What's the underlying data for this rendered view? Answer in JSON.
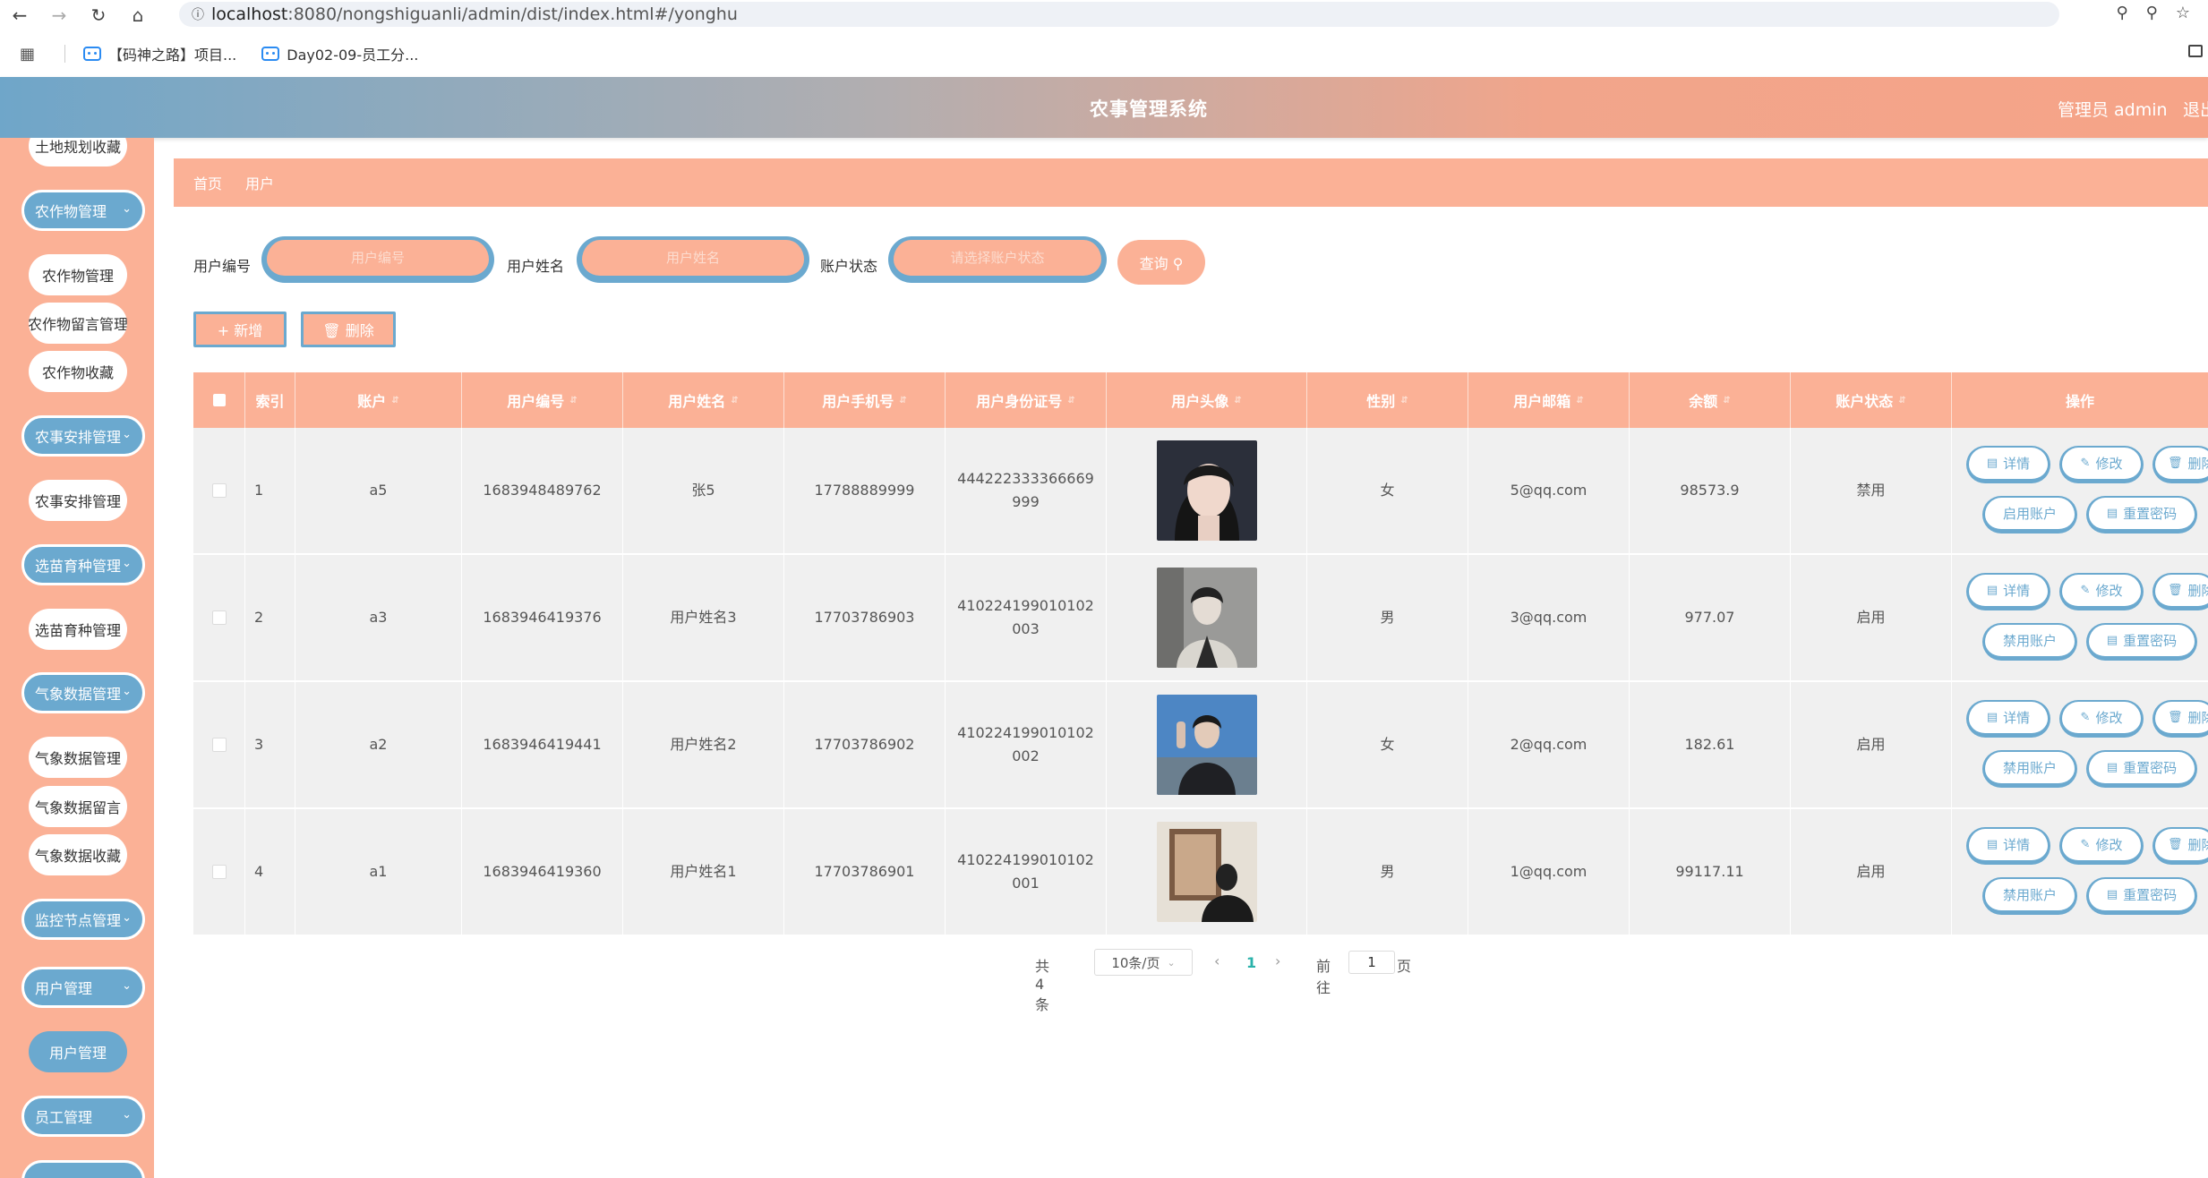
{
  "browser": {
    "url_host": "localhost",
    "url_rest": ":8080/nongshiguanli/admin/dist/index.html#/yonghu",
    "bookmarks": [
      "【码神之路】项目...",
      "Day02-09-员工分..."
    ]
  },
  "header": {
    "title": "农事管理系统",
    "user": "管理员 admin",
    "logout": "退出"
  },
  "sidebar": {
    "items": [
      {
        "label": "土地规划收藏",
        "kind": "sub"
      },
      {
        "label": "农作物管理",
        "kind": "group"
      },
      {
        "label": "农作物管理",
        "kind": "sub"
      },
      {
        "label": "农作物留言管理",
        "kind": "sub"
      },
      {
        "label": "农作物收藏",
        "kind": "sub"
      },
      {
        "label": "农事安排管理",
        "kind": "group"
      },
      {
        "label": "农事安排管理",
        "kind": "sub"
      },
      {
        "label": "选苗育种管理",
        "kind": "group"
      },
      {
        "label": "选苗育种管理",
        "kind": "sub"
      },
      {
        "label": "气象数据管理",
        "kind": "group"
      },
      {
        "label": "气象数据管理",
        "kind": "sub"
      },
      {
        "label": "气象数据留言",
        "kind": "sub"
      },
      {
        "label": "气象数据收藏",
        "kind": "sub"
      },
      {
        "label": "监控节点管理",
        "kind": "group"
      },
      {
        "label": "用户管理",
        "kind": "group"
      },
      {
        "label": "用户管理",
        "kind": "active"
      },
      {
        "label": "员工管理",
        "kind": "group"
      }
    ]
  },
  "breadcrumb": {
    "home": "首页",
    "current": "用户"
  },
  "search": {
    "number_label": "用户编号",
    "number_placeholder": "用户编号",
    "name_label": "用户姓名",
    "name_placeholder": "用户姓名",
    "status_label": "账户状态",
    "status_placeholder": "请选择账户状态",
    "query_label": "查询"
  },
  "actions": {
    "add_label": "新增",
    "delete_label": "删除"
  },
  "table": {
    "headers": [
      "索引",
      "账户",
      "用户编号",
      "用户姓名",
      "用户手机号",
      "用户身份证号",
      "用户头像",
      "性别",
      "用户邮箱",
      "余额",
      "账户状态",
      "操作"
    ],
    "rows": [
      {
        "index": "1",
        "account": "a5",
        "number": "1683948489762",
        "name": "张5",
        "phone": "17788889999",
        "idcard": "444222333366669999",
        "gender": "女",
        "email": "5@qq.com",
        "balance": "98573.9",
        "status": "禁用",
        "toggle": "启用账户"
      },
      {
        "index": "2",
        "account": "a3",
        "number": "1683946419376",
        "name": "用户姓名3",
        "phone": "17703786903",
        "idcard": "410224199010102003",
        "gender": "男",
        "email": "3@qq.com",
        "balance": "977.07",
        "status": "启用",
        "toggle": "禁用账户"
      },
      {
        "index": "3",
        "account": "a2",
        "number": "1683946419441",
        "name": "用户姓名2",
        "phone": "17703786902",
        "idcard": "410224199010102002",
        "gender": "女",
        "email": "2@qq.com",
        "balance": "182.61",
        "status": "启用",
        "toggle": "禁用账户"
      },
      {
        "index": "4",
        "account": "a1",
        "number": "1683946419360",
        "name": "用户姓名1",
        "phone": "17703786901",
        "idcard": "410224199010102001",
        "gender": "男",
        "email": "1@qq.com",
        "balance": "99117.11",
        "status": "启用",
        "toggle": "禁用账户"
      }
    ],
    "op_detail": "详情",
    "op_edit": "修改",
    "op_delete": "删除",
    "op_reset": "重置密码"
  },
  "pagination": {
    "total": "共 4 条",
    "page_size": "10条/页",
    "current_page": "1",
    "goto_label": "前往",
    "goto_value": "1",
    "page_suffix": "页"
  },
  "colors": {
    "accent": "#fbb196",
    "blue": "#6ba9cf"
  }
}
